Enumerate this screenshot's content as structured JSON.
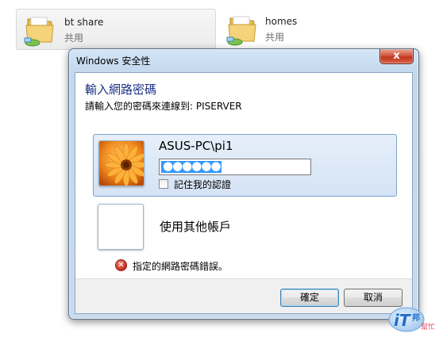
{
  "explorer": {
    "shares": [
      {
        "name": "bt share",
        "type": "共用",
        "selected": true
      },
      {
        "name": "homes",
        "type": "共用",
        "selected": false
      }
    ]
  },
  "dialog": {
    "title": "Windows 安全性",
    "close_label": "x",
    "heading": "輸入網路密碼",
    "subheading": "請輸入您的密碼來連線到: PISERVER",
    "credential": {
      "username": "ASUS-PC\\pi1",
      "password_mask": "●●●●●●",
      "remember_label": "記住我的認證",
      "remember_checked": false
    },
    "other_account_label": "使用其他帳戶",
    "error_message": "指定的網路密碼錯誤。",
    "ok_label": "確定",
    "cancel_label": "取消"
  },
  "watermark": {
    "logo": "iT邦幫忙",
    "icon": "ithome-logo"
  },
  "colors": {
    "heading": "#1e3287",
    "selection": "#3399ff",
    "close_button": "#c1341c",
    "error": "#c8281c"
  }
}
